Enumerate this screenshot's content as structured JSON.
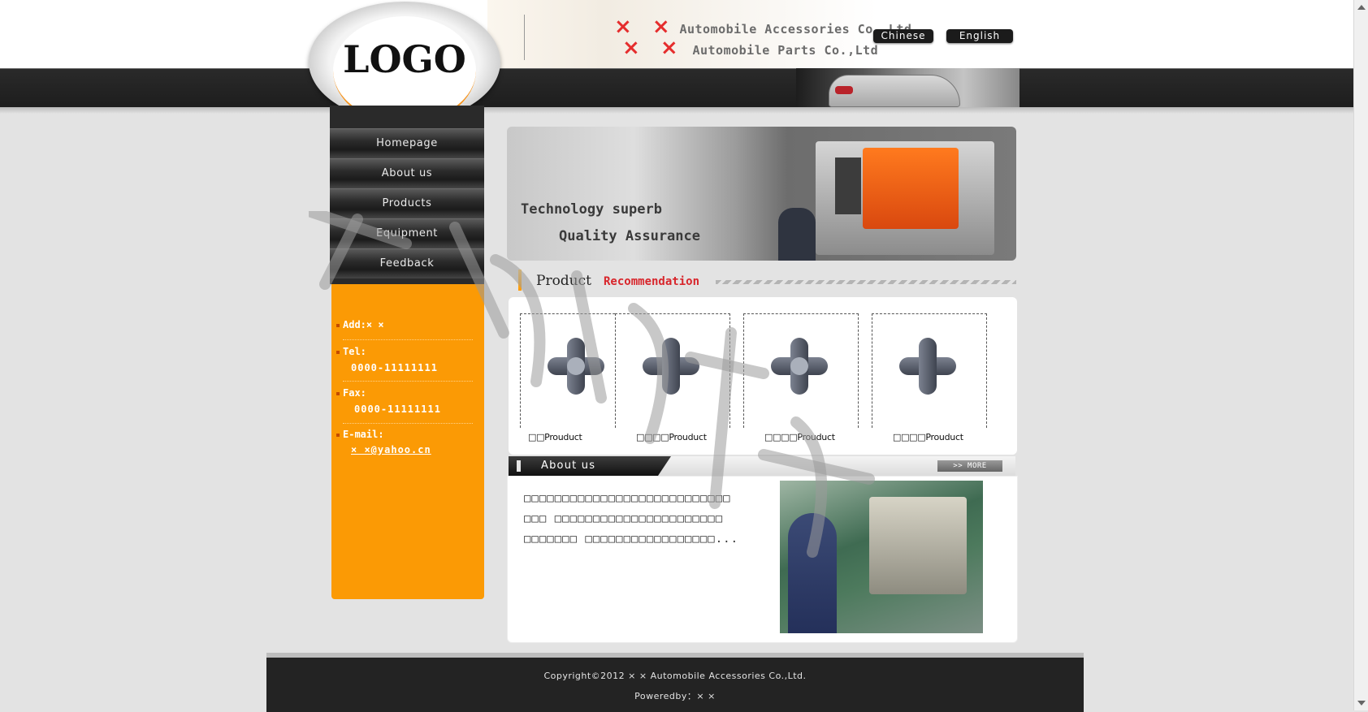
{
  "header": {
    "logo_text": "LOGO",
    "company_lines": [
      {
        "marks": "× ×",
        "name": "Automobile Accessories Co.,Ltd"
      },
      {
        "marks": "× ×",
        "name": "Automobile Parts Co.,Ltd"
      }
    ],
    "languages": [
      "Chinese",
      "English"
    ]
  },
  "nav": {
    "items": [
      "Homepage",
      "About us",
      "Products",
      "Equipment",
      "Feedback"
    ]
  },
  "contact": {
    "add_label": "Add:× ×",
    "tel_label": "Tel:",
    "tel_value": "0000-11111111",
    "fax_label": "Fax:",
    "fax_value": "0000-11111111",
    "email_label": "E-mail:",
    "email_value": "× ×@yahoo.cn"
  },
  "banner": {
    "line1": "Technology superb",
    "line2": "Quality Assurance"
  },
  "products": {
    "title_part1": "Product",
    "title_part2": "Recommendation",
    "items": [
      {
        "label": "□□Prouduct"
      },
      {
        "label": "□□□□Prouduct"
      },
      {
        "label": "□□□□Prouduct"
      },
      {
        "label": "□□□□Prouduct"
      }
    ]
  },
  "about": {
    "title": "About us",
    "more_label": ">> MORE",
    "lines": [
      "□□□□□□□□□□□□□□□□□□□□□□□□□□□",
      "□□□ □□□□□□□□□□□□□□□□□□□□□□",
      "□□□□□□□ □□□□□□□□□□□□□□□□□..."
    ]
  },
  "footer": {
    "copyright": "Copyright©2012 × × Automobile Accessories Co.,Ltd.",
    "powered": "Poweredby：× ×"
  },
  "colors": {
    "accent_orange": "#fb9a05",
    "dark_bar": "#1d1d1d",
    "highlight_red": "#d8262c"
  }
}
